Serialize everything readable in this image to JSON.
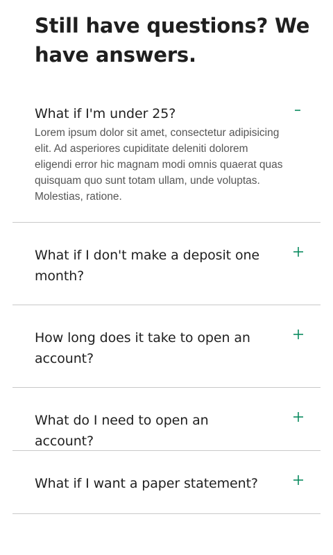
{
  "heading": "Still have questions? We have answers.",
  "accent_color": "#0a8a5f",
  "faq": [
    {
      "question": "What if I'm under 25?",
      "answer": "Lorem ipsum dolor sit amet, consectetur adipisicing elit. Ad asperiores cupiditate deleniti dolorem eligendi error hic magnam modi omnis quaerat quas quisquam quo sunt totam ullam, unde voluptas. Molestias, ratione.",
      "expanded": true,
      "icon": "minus-icon"
    },
    {
      "question": "What if I don't make a deposit one month?",
      "expanded": false,
      "icon": "plus-icon"
    },
    {
      "question": "How long does it take to open an account?",
      "expanded": false,
      "icon": "plus-icon"
    },
    {
      "question": "What do I need to open an account?",
      "expanded": false,
      "icon": "plus-icon"
    },
    {
      "question": "What if I want a paper statement?",
      "expanded": false,
      "icon": "plus-icon"
    }
  ]
}
